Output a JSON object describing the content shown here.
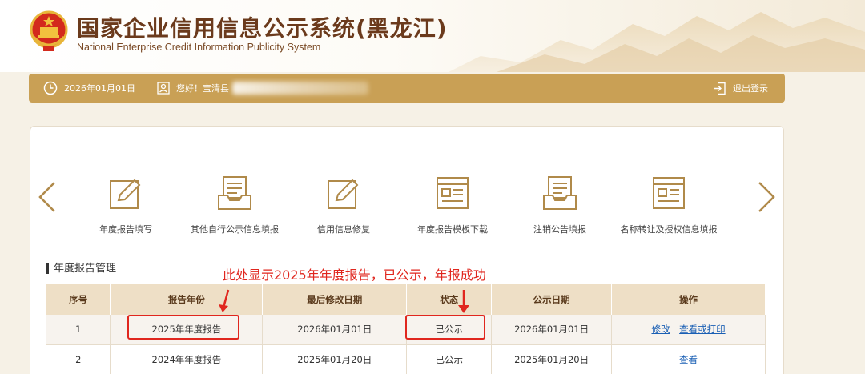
{
  "header": {
    "title": "国家企业信用信息公示系统(黑龙江)",
    "subtitle": "National Enterprise Credit Information Publicity System"
  },
  "infobar": {
    "date": "2026年01月01日",
    "greeting": "您好！宝清县",
    "logout": "退出登录"
  },
  "functions": [
    {
      "label": "年度报告填写",
      "icon": "edit-icon"
    },
    {
      "label": "其他自行公示信息填报",
      "icon": "inbox-icon"
    },
    {
      "label": "信用信息修复",
      "icon": "edit-icon"
    },
    {
      "label": "年度报告模板下载",
      "icon": "document-icon"
    },
    {
      "label": "注销公告填报",
      "icon": "inbox-icon"
    },
    {
      "label": "名称转让及授权信息填报",
      "icon": "document-icon"
    }
  ],
  "section": {
    "title": "年度报告管理",
    "note": "此处显示2025年年度报告，已公示，年报成功"
  },
  "table": {
    "headers": [
      "序号",
      "报告年份",
      "最后修改日期",
      "状态",
      "公示日期",
      "操作"
    ],
    "rows": [
      {
        "no": "1",
        "year": "2025年年度报告",
        "modified": "2026年01月01日",
        "status": "已公示",
        "published": "2026年01月01日",
        "ops": [
          "修改",
          "查看或打印"
        ]
      },
      {
        "no": "2",
        "year": "2024年年度报告",
        "modified": "2025年01月20日",
        "status": "已公示",
        "published": "2025年01月20日",
        "ops": [
          "查看"
        ]
      }
    ]
  },
  "colors": {
    "accent": "#c9a055",
    "header_text": "#6b3a1c",
    "table_header_bg": "#eedfc6",
    "highlight_red": "#e0261e",
    "link": "#1a5fb4"
  }
}
